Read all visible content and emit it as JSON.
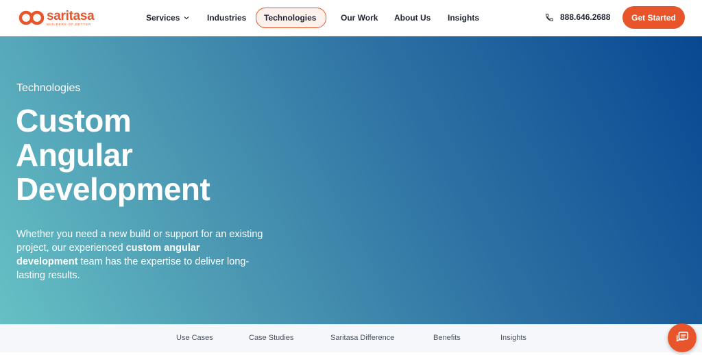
{
  "brand": {
    "name": "saritasa",
    "tagline": "BUILDERS OF BETTER",
    "accent_color": "#e8552a"
  },
  "nav": {
    "items": [
      {
        "label": "Services",
        "has_dropdown": true
      },
      {
        "label": "Industries",
        "has_dropdown": false
      },
      {
        "label": "Technologies",
        "has_dropdown": true,
        "active": true
      },
      {
        "label": "Our Work",
        "has_dropdown": false
      },
      {
        "label": "About Us",
        "has_dropdown": false
      },
      {
        "label": "Insights",
        "has_dropdown": false
      }
    ],
    "phone": "888.646.2688",
    "cta_label": "Get Started"
  },
  "hero": {
    "eyebrow": "Technologies",
    "title_lines": [
      "Custom",
      "Angular",
      "Development"
    ],
    "description_parts": [
      "Whether you need a new build or support for an existing project, our experienced ",
      "custom angular development",
      " team has the expertise to deliver long-lasting results."
    ]
  },
  "subnav": {
    "items": [
      "Use Cases",
      "Case Studies",
      "Saritasa Difference",
      "Benefits",
      "Insights"
    ]
  },
  "icons": {
    "phone": "phone-icon",
    "chevron": "chevron-down-icon",
    "chat": "chat-icon",
    "logo": "saritasa-logo-icon"
  }
}
